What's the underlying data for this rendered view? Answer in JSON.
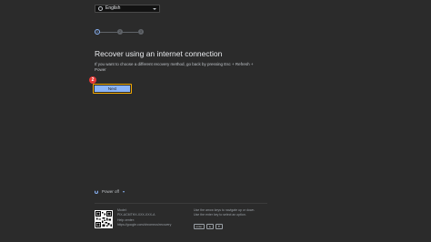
{
  "language": {
    "selected": "English"
  },
  "stepper": {
    "step1": "1",
    "step2": "2",
    "step3": "3"
  },
  "page": {
    "title": "Recover using an internet connection",
    "description": "If you want to choose a different recovery method, go back by pressing Esc + Refresh + Power"
  },
  "annotation": {
    "badge": "2"
  },
  "actions": {
    "next_label": "Next"
  },
  "footer": {
    "power_label": "Power off",
    "model_line": "Model:",
    "model_value": "PIX-ACMTHX-XXX-XXX-A",
    "help_label": "Help center:",
    "help_url": "https://google.com/chromeos/recovery",
    "hint_navigate": "Use the arrow keys to navigate up or down.",
    "hint_select": "Use the enter key to select an option.",
    "key_enter": "enter",
    "key_up": "▲",
    "key_down": "▼"
  },
  "colors": {
    "accent": "#8ab4f8",
    "highlight": "#f2a900",
    "badge": "#e53935",
    "background": "#2b2b2b"
  }
}
